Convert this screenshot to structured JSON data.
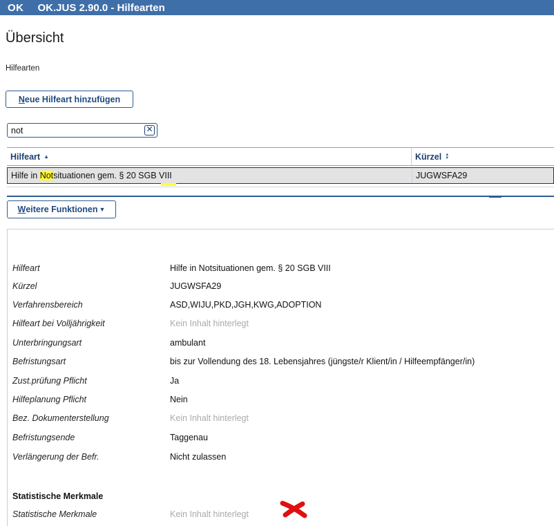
{
  "window": {
    "logo": "OK",
    "title": "OK.JUS 2.90.0 - Hilfearten"
  },
  "page": {
    "title": "Übersicht",
    "subtitle": "Hilfearten"
  },
  "buttons": {
    "new_first": "N",
    "new_rest": "eue Hilfeart hinzufügen",
    "more_first": "W",
    "more_rest": "eitere Funktionen"
  },
  "search": {
    "value": "not",
    "clear_icon": "clear-search-icon"
  },
  "grid": {
    "columns": [
      {
        "label": "Hilfeart",
        "sort": "ascending"
      },
      {
        "label": "Kürzel",
        "sort": "sortable"
      }
    ],
    "rows": [
      {
        "hilfeart_pre": "Hilfe in ",
        "hilfeart_match": "Not",
        "hilfeart_post": "situationen gem. § 20 SGB VIII",
        "kuerzel": "JUGWSFA29"
      }
    ]
  },
  "details": {
    "rows": [
      {
        "label": "Hilfeart",
        "value": "Hilfe in Notsituationen gem. § 20 SGB VIII",
        "empty": false
      },
      {
        "label": "Kürzel",
        "value": "JUGWSFA29",
        "empty": false
      },
      {
        "label": "Verfahrensbereich",
        "value": "ASD,WIJU,PKD,JGH,KWG,ADOPTION",
        "empty": false
      },
      {
        "label": "Hilfeart bei Volljährigkeit",
        "value": "Kein Inhalt hinterlegt",
        "empty": true
      },
      {
        "label": "Unterbringungsart",
        "value": "ambulant",
        "empty": false
      },
      {
        "label": "Befristungsart",
        "value": "bis zur Vollendung des 18. Lebensjahres (jüngste/r Klient/in / Hilfeempfänger/in)",
        "empty": false
      },
      {
        "label": "Zust.prüfung Pflicht",
        "value": "Ja",
        "empty": false
      },
      {
        "label": "Hilfeplanung Pflicht",
        "value": "Nein",
        "empty": false
      },
      {
        "label": "Bez. Dokumenterstellung",
        "value": "Kein Inhalt hinterlegt",
        "empty": true
      },
      {
        "label": "Befristungsende",
        "value": "Taggenau",
        "empty": false
      },
      {
        "label": "Verlängerung der Befr.",
        "value": "Nicht zulassen",
        "empty": false
      }
    ],
    "section_title": "Statistische Merkmale",
    "stat_row": {
      "label": "Statistische Merkmale",
      "value": "Kein Inhalt hinterlegt"
    }
  },
  "colors": {
    "titlebar": "#3f6fa8",
    "accent": "#2d5a93",
    "highlight": "#ffff33",
    "annotation": "#e01010"
  }
}
